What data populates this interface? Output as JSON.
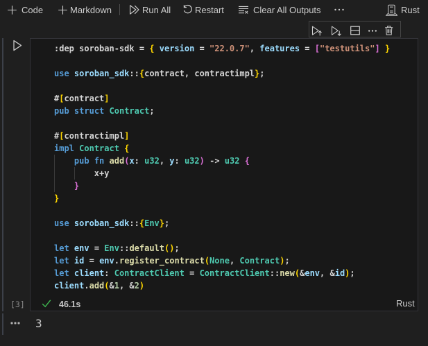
{
  "toolbar": {
    "code_label": "Code",
    "markdown_label": "Markdown",
    "run_all_label": "Run All",
    "restart_label": "Restart",
    "clear_outputs_label": "Clear All Outputs",
    "kernel_label": "Rust"
  },
  "cell_toolbar": {
    "items": [
      "execute-above",
      "execute-below",
      "split-cell",
      "more-actions",
      "delete-cell"
    ]
  },
  "cell": {
    "execution_order": "[3]",
    "status": {
      "duration": "46.1s",
      "language": "Rust"
    },
    "code_lines": [
      [
        [
          "pln",
          ":dep soroban-sdk = "
        ],
        [
          "b1",
          "{"
        ],
        [
          "pln",
          " "
        ],
        [
          "var",
          "version"
        ],
        [
          "pln",
          " = "
        ],
        [
          "str",
          "\"22.0.7\""
        ],
        [
          "pln",
          ", "
        ],
        [
          "var",
          "features"
        ],
        [
          "pln",
          " = "
        ],
        [
          "b2",
          "["
        ],
        [
          "str",
          "\"testutils\""
        ],
        [
          "b2",
          "]"
        ],
        [
          "pln",
          " "
        ],
        [
          "b1",
          "}"
        ]
      ],
      [],
      [
        [
          "kw",
          "use"
        ],
        [
          "pln",
          " "
        ],
        [
          "var",
          "soroban_sdk"
        ],
        [
          "pln",
          "::"
        ],
        [
          "b1",
          "{"
        ],
        [
          "pln",
          "contract, contractimpl"
        ],
        [
          "b1",
          "}"
        ],
        [
          "pln",
          ";"
        ]
      ],
      [],
      [
        [
          "pln",
          "#"
        ],
        [
          "b1",
          "["
        ],
        [
          "pln",
          "contract"
        ],
        [
          "b1",
          "]"
        ]
      ],
      [
        [
          "kw",
          "pub"
        ],
        [
          "pln",
          " "
        ],
        [
          "kw",
          "struct"
        ],
        [
          "pln",
          " "
        ],
        [
          "typ",
          "Contract"
        ],
        [
          "pln",
          ";"
        ]
      ],
      [],
      [
        [
          "pln",
          "#"
        ],
        [
          "b1",
          "["
        ],
        [
          "pln",
          "contractimpl"
        ],
        [
          "b1",
          "]"
        ]
      ],
      [
        [
          "kw",
          "impl"
        ],
        [
          "pln",
          " "
        ],
        [
          "typ",
          "Contract"
        ],
        [
          "pln",
          " "
        ],
        [
          "b1",
          "{"
        ]
      ],
      [
        [
          "pln",
          "    "
        ],
        [
          "kw",
          "pub"
        ],
        [
          "pln",
          " "
        ],
        [
          "kw",
          "fn"
        ],
        [
          "pln",
          " "
        ],
        [
          "fn",
          "add"
        ],
        [
          "b2",
          "("
        ],
        [
          "var",
          "x"
        ],
        [
          "pln",
          ": "
        ],
        [
          "typ",
          "u32"
        ],
        [
          "pln",
          ", "
        ],
        [
          "var",
          "y"
        ],
        [
          "pln",
          ": "
        ],
        [
          "typ",
          "u32"
        ],
        [
          "b2",
          ")"
        ],
        [
          "pln",
          " -> "
        ],
        [
          "typ",
          "u32"
        ],
        [
          "pln",
          " "
        ],
        [
          "b2",
          "{"
        ]
      ],
      [
        [
          "pln",
          "        x+y"
        ]
      ],
      [
        [
          "pln",
          "    "
        ],
        [
          "b2",
          "}"
        ]
      ],
      [
        [
          "b1",
          "}"
        ]
      ],
      [],
      [
        [
          "kw",
          "use"
        ],
        [
          "pln",
          " "
        ],
        [
          "var",
          "soroban_sdk"
        ],
        [
          "pln",
          "::"
        ],
        [
          "b1",
          "{"
        ],
        [
          "typ",
          "Env"
        ],
        [
          "b1",
          "}"
        ],
        [
          "pln",
          ";"
        ]
      ],
      [],
      [
        [
          "kw",
          "let"
        ],
        [
          "pln",
          " "
        ],
        [
          "var",
          "env"
        ],
        [
          "pln",
          " = "
        ],
        [
          "typ",
          "Env"
        ],
        [
          "pln",
          "::"
        ],
        [
          "fn",
          "default"
        ],
        [
          "b1",
          "()"
        ],
        [
          "pln",
          ";"
        ]
      ],
      [
        [
          "kw",
          "let"
        ],
        [
          "pln",
          " "
        ],
        [
          "var",
          "id"
        ],
        [
          "pln",
          " = "
        ],
        [
          "var",
          "env"
        ],
        [
          "pln",
          "."
        ],
        [
          "fn",
          "register_contract"
        ],
        [
          "b1",
          "("
        ],
        [
          "typ",
          "None"
        ],
        [
          "pln",
          ", "
        ],
        [
          "typ",
          "Contract"
        ],
        [
          "b1",
          ")"
        ],
        [
          "pln",
          ";"
        ]
      ],
      [
        [
          "kw",
          "let"
        ],
        [
          "pln",
          " "
        ],
        [
          "var",
          "client"
        ],
        [
          "pln",
          ": "
        ],
        [
          "typ",
          "ContractClient"
        ],
        [
          "pln",
          " = "
        ],
        [
          "typ",
          "ContractClient"
        ],
        [
          "pln",
          "::"
        ],
        [
          "fn",
          "new"
        ],
        [
          "b1",
          "("
        ],
        [
          "pln",
          "&"
        ],
        [
          "var",
          "env"
        ],
        [
          "pln",
          ", &"
        ],
        [
          "var",
          "id"
        ],
        [
          "b1",
          ")"
        ],
        [
          "pln",
          ";"
        ]
      ],
      [
        [
          "var",
          "client"
        ],
        [
          "pln",
          "."
        ],
        [
          "fn",
          "add"
        ],
        [
          "b1",
          "("
        ],
        [
          "pln",
          "&"
        ],
        [
          "num",
          "1"
        ],
        [
          "pln",
          ", &"
        ],
        [
          "num",
          "2"
        ],
        [
          "b1",
          ")"
        ]
      ]
    ]
  },
  "output": {
    "value": "3"
  },
  "colors": {
    "background": "#1f1f1f",
    "editor_background": "#181818",
    "foreground": "#cccccc",
    "keyword": "#569cd6",
    "type": "#4ec9b0",
    "function": "#dcdcaa",
    "variable": "#9cdcfe",
    "string": "#ce9178",
    "number": "#b5cea8",
    "bracket1": "#ffd700",
    "bracket2": "#da70d6",
    "success": "#3fb950"
  }
}
